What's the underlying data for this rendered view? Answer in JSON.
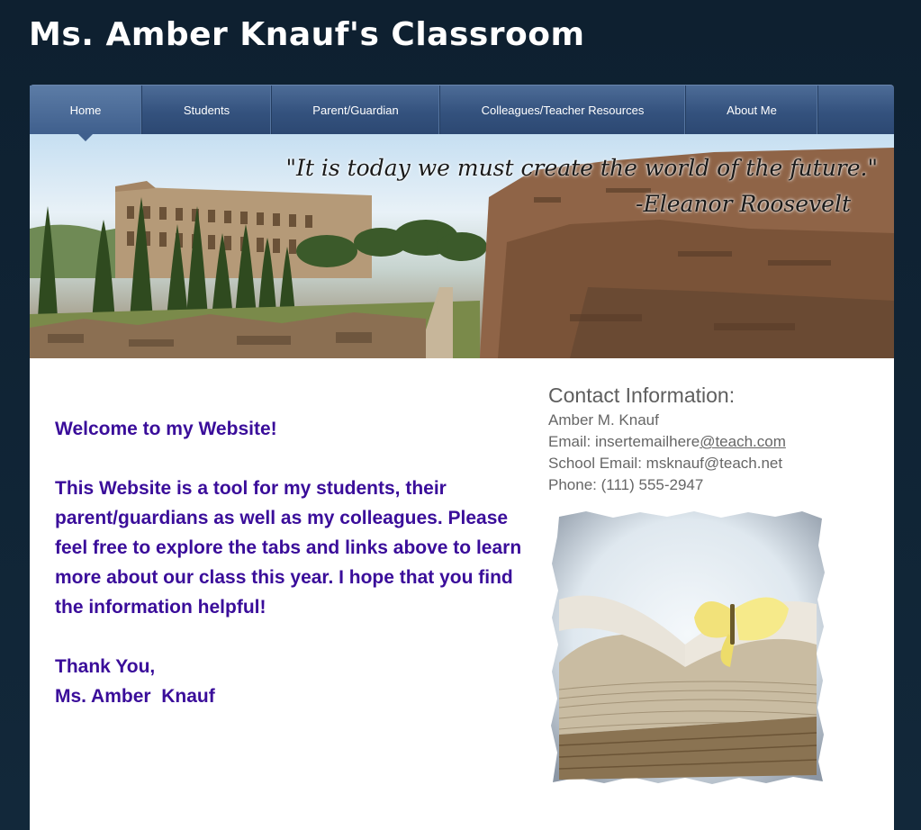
{
  "site": {
    "title": "Ms. Amber Knauf's Classroom"
  },
  "nav": {
    "items": [
      {
        "label": "Home"
      },
      {
        "label": "Students"
      },
      {
        "label": "Parent/Guardian"
      },
      {
        "label": "Colleagues/Teacher Resources"
      },
      {
        "label": "About Me"
      }
    ]
  },
  "banner": {
    "quote": "\"It is today we must create the world of the future.\"",
    "author": "-Eleanor Roosevelt"
  },
  "welcome": {
    "heading": "Welcome to my Website!",
    "body": "This Website is a tool for my students, their parent/guardians as well as my colleagues. Please feel free to explore the tabs and links above to learn more about our class this year. I hope that you find the information helpful!",
    "closing": "Thank You,",
    "signature": "Ms. Amber  Knauf"
  },
  "contact": {
    "heading": "Contact Information:",
    "name": "Amber M. Knauf",
    "email_prefix": "Email: insertemailhere",
    "email_link": "@teach.com",
    "school_email": "School Email: msknauf@teach.net",
    "phone": "Phone: (111) 555-2947"
  }
}
